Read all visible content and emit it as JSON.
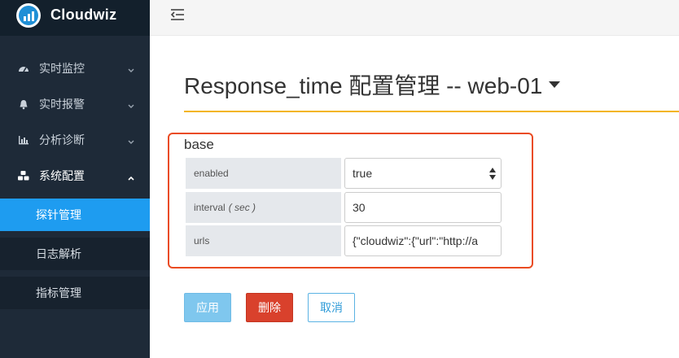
{
  "app": {
    "brand": "Cloudwiz"
  },
  "sidebar": {
    "menus": [
      {
        "label": "实时监控",
        "icon": "dashboard-icon"
      },
      {
        "label": "实时报警",
        "icon": "bell-icon"
      },
      {
        "label": "分析诊断",
        "icon": "bar-chart-icon"
      },
      {
        "label": "系统配置",
        "icon": "cubes-icon"
      }
    ],
    "submenu": [
      {
        "label": "探针管理",
        "active": true
      },
      {
        "label": "日志解析",
        "active": false
      },
      {
        "label": "指标管理",
        "active": false
      }
    ]
  },
  "page": {
    "title": "Response_time 配置管理 -- web-01",
    "section": "base"
  },
  "form": {
    "enabled": {
      "label": "enabled",
      "value": "true"
    },
    "interval": {
      "label": "interval",
      "unit": "( sec )",
      "value": "30"
    },
    "urls": {
      "label": "urls",
      "value": "{\"cloudwiz\":{\"url\":\"http://a"
    }
  },
  "buttons": {
    "apply": "应用",
    "delete": "删除",
    "cancel": "取消"
  },
  "colors": {
    "accent": "#1e9cf0",
    "rule": "#f3b51b",
    "highlight": "#ea4b21",
    "danger": "#d9412c"
  }
}
